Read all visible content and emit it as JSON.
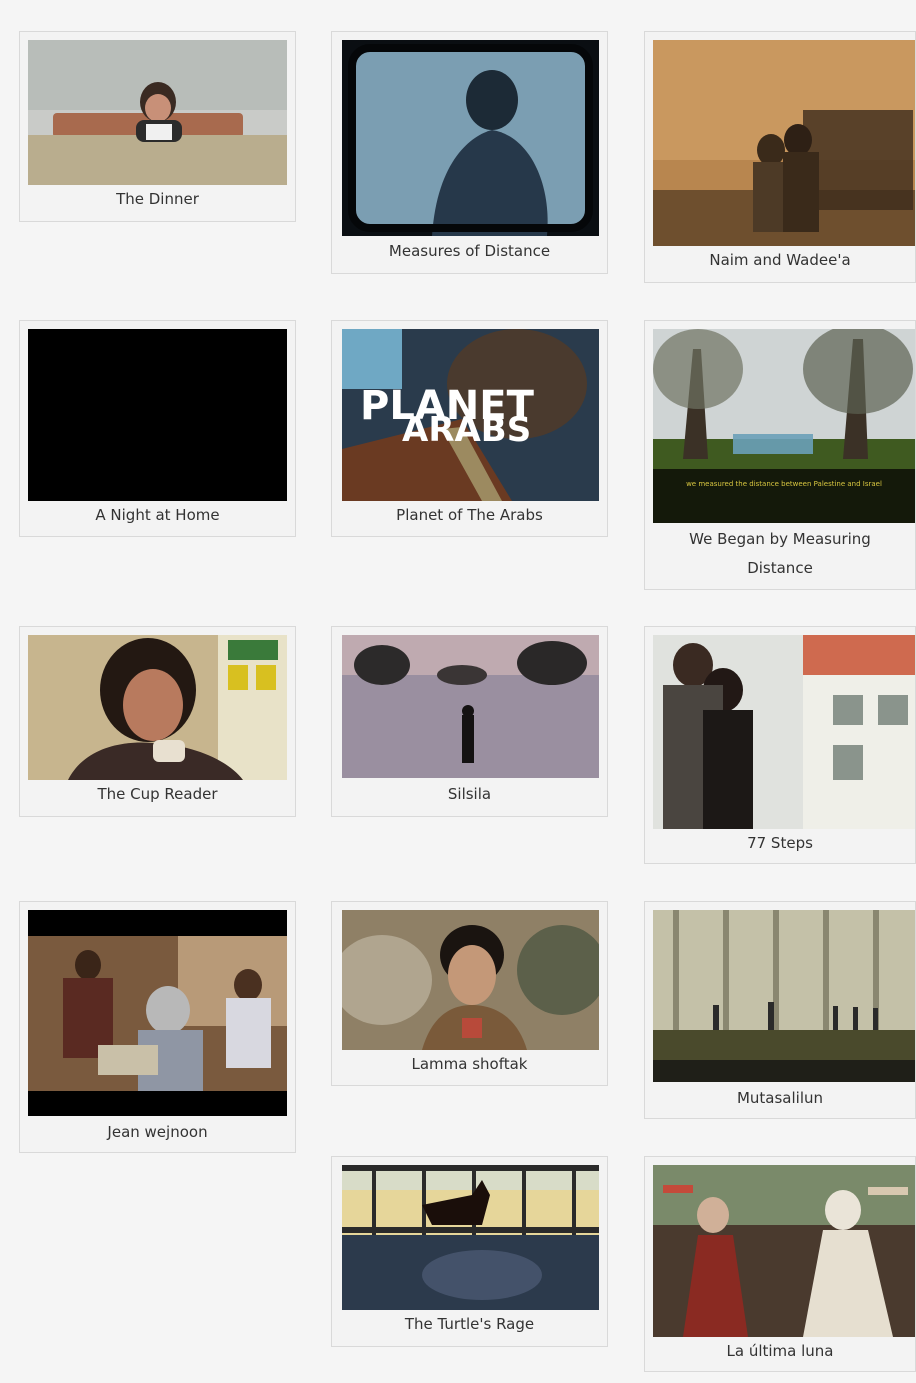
{
  "films": [
    {
      "title": "The Dinner",
      "thumbnail": "woman-at-table-thumbnail"
    },
    {
      "title": "Measures of Distance",
      "thumbnail": "silhouette-shower-thumbnail"
    },
    {
      "title": "Naim and Wadee'a",
      "thumbnail": "sepia-couple-photo-thumbnail"
    },
    {
      "title": "A Night at Home",
      "thumbnail": "black-frame-thumbnail"
    },
    {
      "title": "Planet of The Arabs",
      "thumbnail": "planet-of-the-arabs-poster-thumbnail",
      "overlay_text_1": "PLANET",
      "overlay_text_2": "ARABS"
    },
    {
      "title": "We Began by Measuring Distance",
      "thumbnail": "trees-field-thumbnail",
      "subtitle_text": "we measured the distance between Palestine and Israel"
    },
    {
      "title": "The Cup Reader",
      "thumbnail": "woman-with-cup-thumbnail"
    },
    {
      "title": "Silsila",
      "thumbnail": "lake-silhouette-thumbnail"
    },
    {
      "title": "77 Steps",
      "thumbnail": "couple-on-balcony-thumbnail"
    },
    {
      "title": "Jean wejnoon",
      "thumbnail": "family-dinner-thumbnail"
    },
    {
      "title": "Lamma shoftak",
      "thumbnail": "boy-portrait-thumbnail"
    },
    {
      "title": "Mutasalilun",
      "thumbnail": "wall-figures-thumbnail"
    },
    {
      "title": "The Turtle's Rage",
      "thumbnail": "horse-and-fence-thumbnail"
    },
    {
      "title": "La última luna",
      "thumbnail": "dancing-women-thumbnail"
    }
  ]
}
